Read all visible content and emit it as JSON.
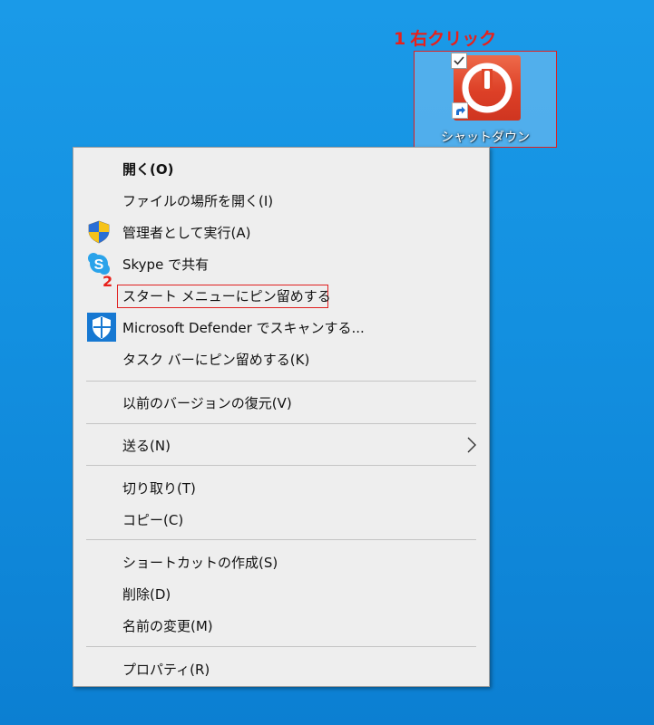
{
  "annotations": {
    "step1_number": "1",
    "step1_text": "右クリック",
    "step2_number": "2"
  },
  "desktop_icon": {
    "label": "シャットダウン",
    "icon": "power-icon",
    "checkbox_checked": true,
    "shortcut_overlay": "shortcut-arrow-icon"
  },
  "context_menu": {
    "items": [
      {
        "label": "開く(O)",
        "bold": true
      },
      {
        "label": "ファイルの場所を開く(I)"
      },
      {
        "label": "管理者として実行(A)",
        "icon": "uac-shield-icon"
      },
      {
        "label": "Skype で共有",
        "icon": "skype-icon"
      },
      {
        "label": "スタート メニューにピン留めする",
        "highlighted": true
      },
      {
        "label": "Microsoft Defender でスキャンする...",
        "icon": "defender-shield-icon"
      },
      {
        "label": "タスク バーにピン留めする(K)"
      },
      {
        "label": "以前のバージョンの復元(V)"
      },
      {
        "label": "送る(N)",
        "submenu": true
      },
      {
        "label": "切り取り(T)"
      },
      {
        "label": "コピー(C)"
      },
      {
        "label": "ショートカットの作成(S)"
      },
      {
        "label": "削除(D)"
      },
      {
        "label": "名前の変更(M)"
      },
      {
        "label": "プロパティ(R)"
      }
    ]
  },
  "colors": {
    "annotation_red": "#e8201a",
    "desktop_blue": "#1390e0",
    "menu_background": "#eeeeee"
  }
}
